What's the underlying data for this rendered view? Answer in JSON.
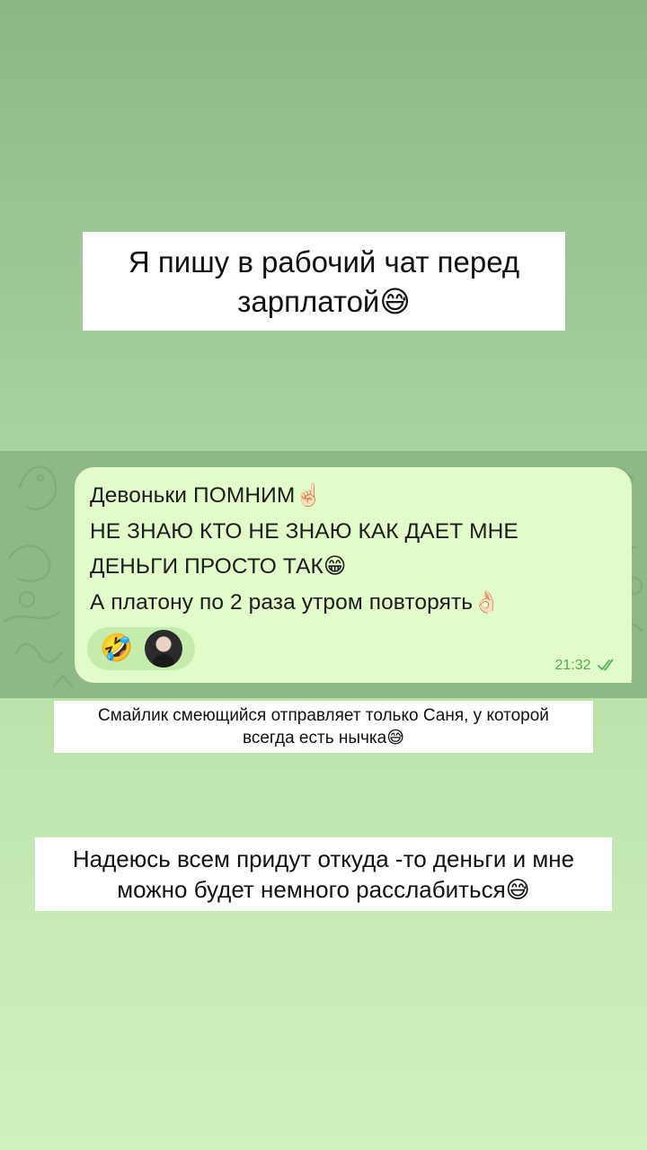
{
  "captions": {
    "top": {
      "lines": [
        "Я пишу в рабочий чат перед",
        "зарплатой"
      ],
      "emoji": "😅"
    },
    "middle": {
      "lines": [
        "Смайлик смеющийся отправляет только Саня, у которой",
        "всегда есть нычка"
      ],
      "emoji": "😅"
    },
    "bottom": {
      "lines": [
        "Надеюсь всем придут откуда -то деньги и мне",
        "можно будет немного расслабиться"
      ],
      "emoji": "😅"
    }
  },
  "chat": {
    "message": {
      "lines": [
        "Девоньки ПОМНИМ☝🏻",
        "НЕ ЗНАЮ КТО НЕ ЗНАЮ КАК ДАЕТ МНЕ",
        "ДЕНЬГИ ПРОСТО ТАК😁",
        "А платону по 2 раза утром повторять👌🏻"
      ],
      "time": "21:32",
      "status": "read",
      "reaction": {
        "emoji": "🤣",
        "avatar": "reactor-avatar"
      }
    }
  },
  "colors": {
    "background_top": "#88b886",
    "background_bottom": "#d0f0bc",
    "bubble": "#e1fcc8",
    "timestamp": "#4fae4e"
  }
}
